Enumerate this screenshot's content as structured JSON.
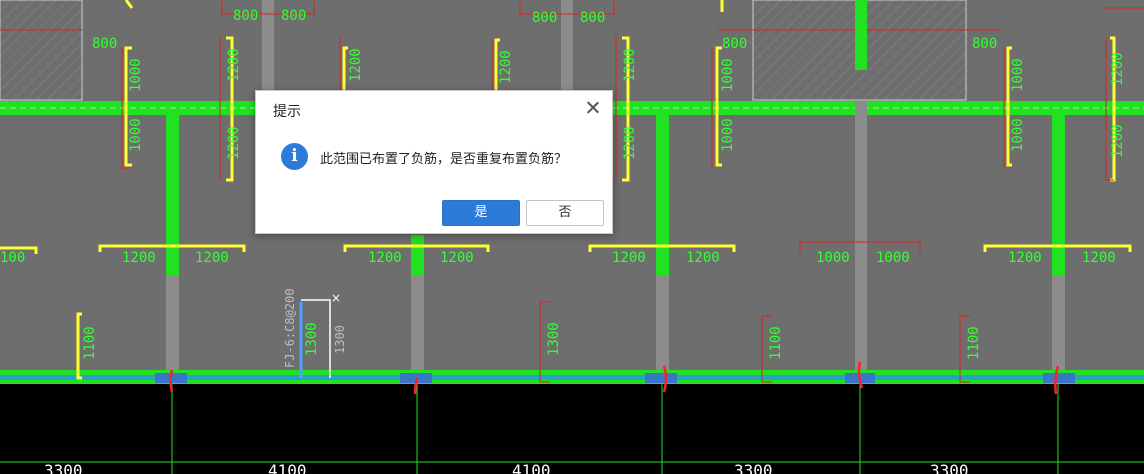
{
  "dialog": {
    "title": "提示",
    "message": "此范围已布置了负筋，是否重复布置负筋？",
    "info_icon_glyph": "i",
    "yes_label": "是",
    "no_label": "否",
    "close_icon": "close-icon"
  },
  "drawing": {
    "colors": {
      "background": "#6e6e6e",
      "beam_green": "#22e022",
      "rebar_yellow": "#ffff33",
      "dim_red": "#e02020",
      "text_green": "#33ff33",
      "axis_blue": "#3a76c8",
      "black_band": "#000000"
    },
    "top_dims": [
      "800",
      "800",
      "800",
      "800",
      "800",
      "800",
      "800",
      "800"
    ],
    "upper_vertical_labels": [
      "1000",
      "1000",
      "1200",
      "1200",
      "1200",
      "1200",
      "1200",
      "1200",
      "1000",
      "1000",
      "1000",
      "1000",
      "1200",
      "1200"
    ],
    "middle_labels": [
      "100",
      "1200",
      "1200",
      "1200",
      "1200",
      "1200",
      "1200",
      "1000",
      "1000",
      "1200",
      "1200"
    ],
    "lower_vertical_labels": [
      "1100",
      "1300",
      "1300",
      "1300",
      "1100",
      "1100"
    ],
    "rebar_tag": "FJ-6:C8@200",
    "axis_spacings": [
      "3300",
      "4100",
      "4100",
      "3300",
      "3300"
    ]
  }
}
